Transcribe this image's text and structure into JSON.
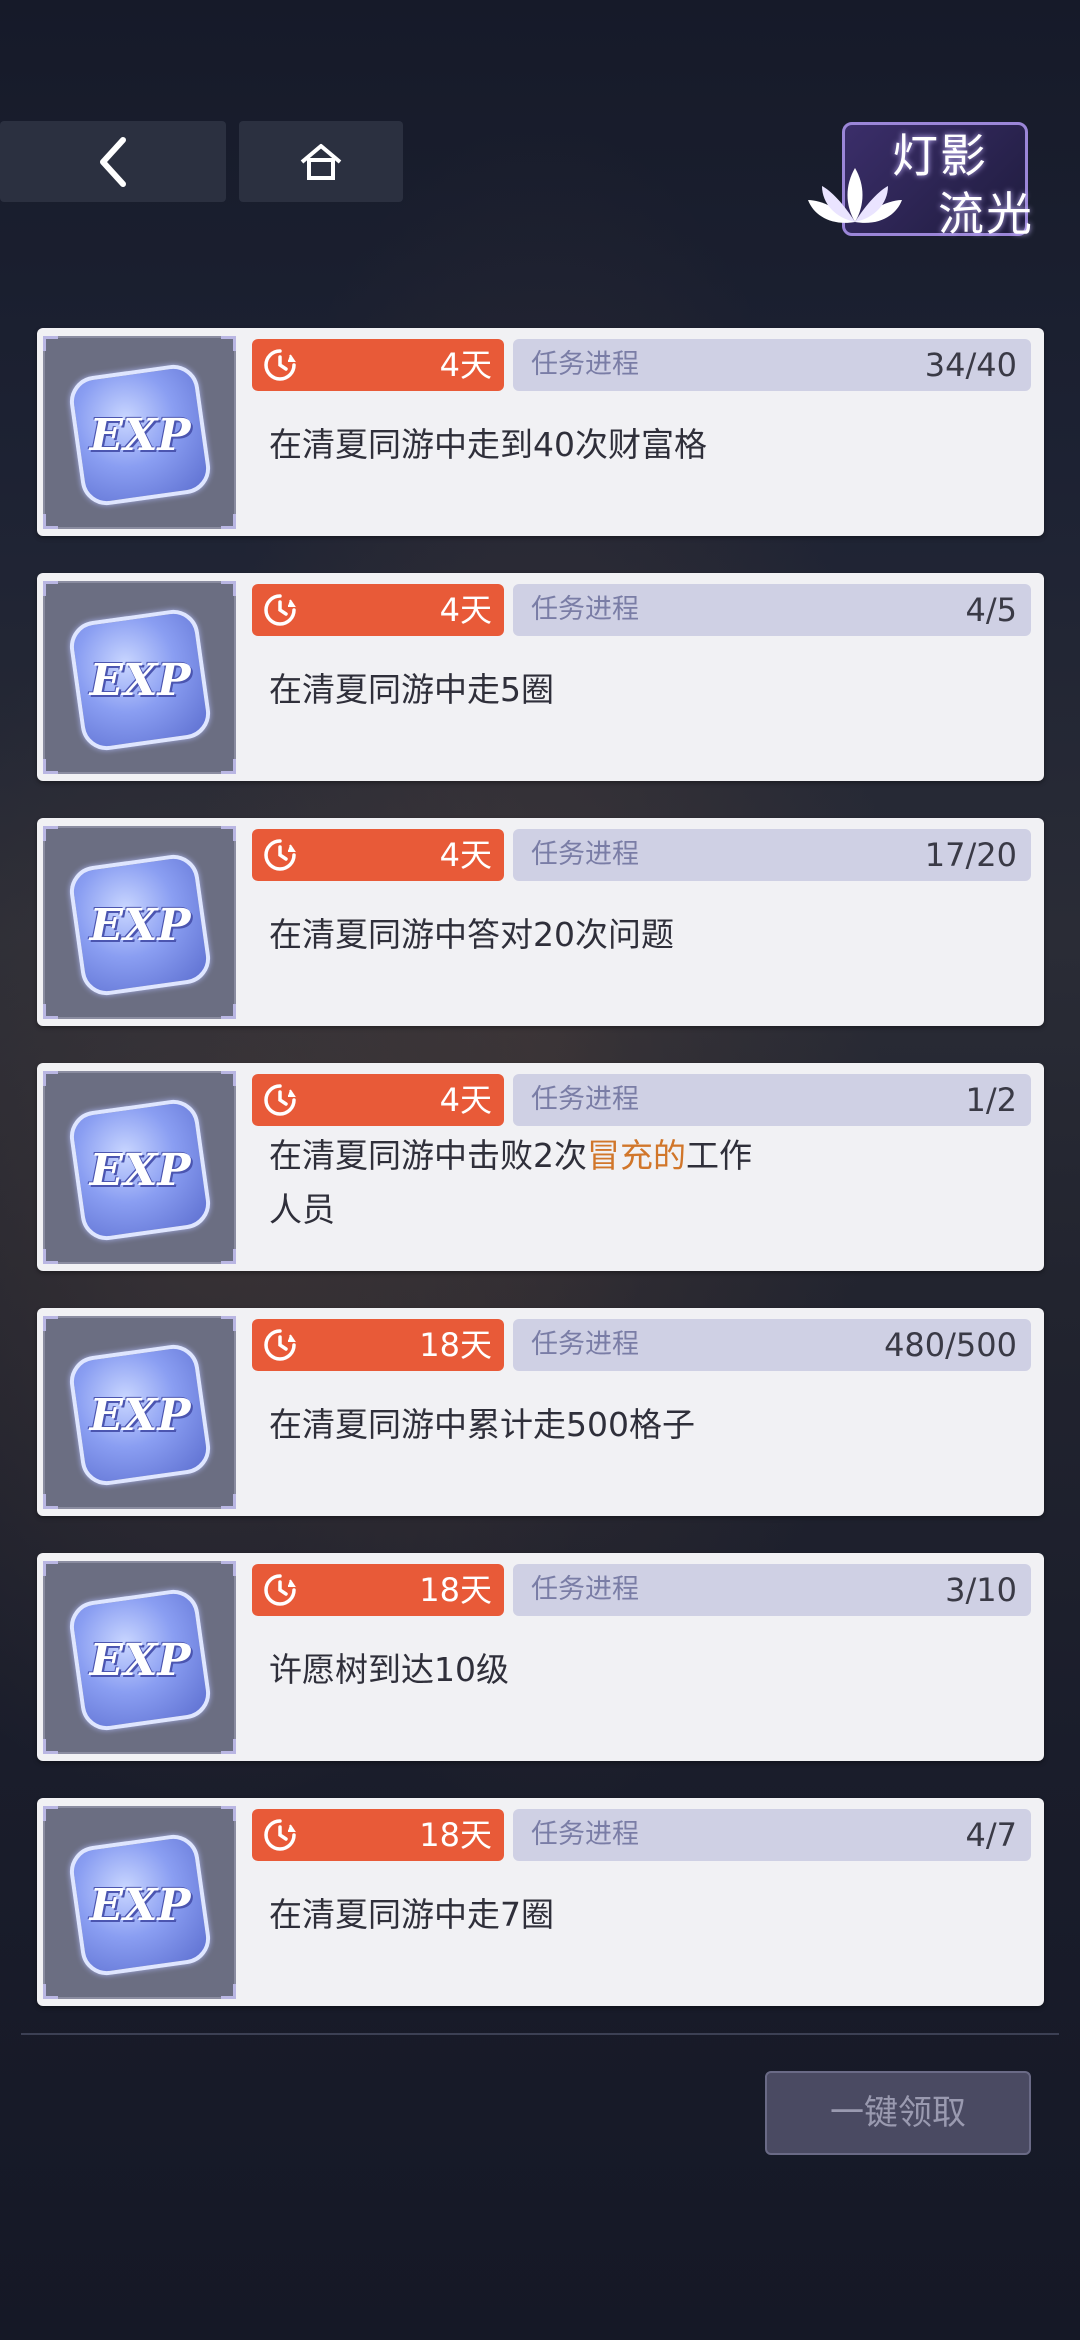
{
  "header": {
    "logo_line1": "灯影",
    "logo_line2": "流光"
  },
  "progress_label": "任务进程",
  "tasks": [
    {
      "days": "4天",
      "progress": "34/40",
      "desc": "在清夏同游中走到40次财富格"
    },
    {
      "days": "4天",
      "progress": "4/5",
      "desc": "在清夏同游中走5圈"
    },
    {
      "days": "4天",
      "progress": "17/20",
      "desc": "在清夏同游中答对20次问题"
    },
    {
      "days": "4天",
      "progress": "1/2",
      "desc_pre": "在清夏同游中击败2次",
      "desc_hl": "冒充的",
      "desc_post": "工作人员"
    },
    {
      "days": "18天",
      "progress": "480/500",
      "desc": "在清夏同游中累计走500格子"
    },
    {
      "days": "18天",
      "progress": "3/10",
      "desc": "许愿树到达10级"
    },
    {
      "days": "18天",
      "progress": "4/7",
      "desc": "在清夏同游中走7圈"
    }
  ],
  "reward_icon_label": "EXP",
  "claim_all_label": "一键领取",
  "colors": {
    "days_pill": "#e85a38",
    "progress_pill": "#cfd0e4",
    "highlight": "#d1762a"
  }
}
